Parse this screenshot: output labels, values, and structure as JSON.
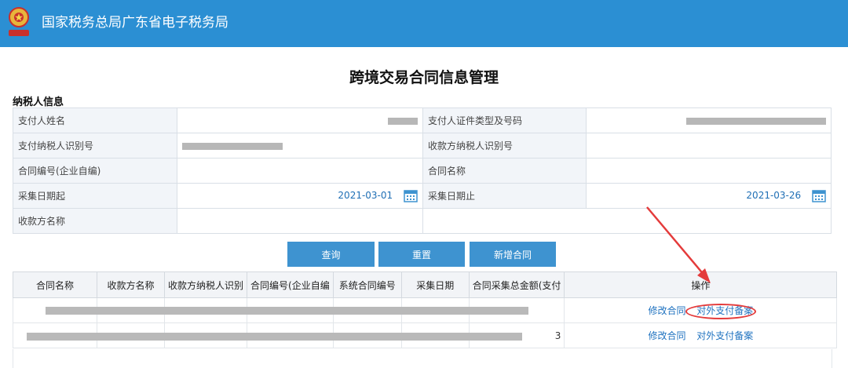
{
  "header": {
    "brand": "国家税务总局广东省电子税务局",
    "emblem": "national-emblem-icon",
    "bg": "#2b8fd3"
  },
  "page": {
    "title": "跨境交易合同信息管理"
  },
  "taxpayer": {
    "section_title": "纳税人信息",
    "payer_name_label": "支付人姓名",
    "payer_id_label": "支付人证件类型及号码",
    "payer_tax_id_label": "支付纳税人识别号",
    "payee_tax_id_label": "收款方纳税人识别号",
    "contract_no_label": "合同编号(企业自编)",
    "contract_name_label": "合同名称",
    "date_start_label": "采集日期起",
    "date_start_value": "2021-03-01",
    "date_end_label": "采集日期止",
    "date_end_value": "2021-03-26",
    "payee_name_label": "收款方名称"
  },
  "actions": {
    "query": "查询",
    "reset": "重置",
    "add_contract": "新增合同"
  },
  "grid": {
    "columns": [
      "合同名称",
      "收款方名称",
      "收款方纳税人识别",
      "合同编号(企业自编",
      "系统合同编号",
      "采集日期",
      "合同采集总金额(支付",
      "操作"
    ],
    "rows": [
      {
        "edit": "修改合同",
        "filing": "对外支付备案"
      },
      {
        "edit": "修改合同",
        "filing": "对外支付备案",
        "amount_tail": "3"
      }
    ]
  },
  "colors": {
    "accent": "#3e93d0",
    "link": "#2073c0",
    "annotation": "#e43b3b"
  }
}
